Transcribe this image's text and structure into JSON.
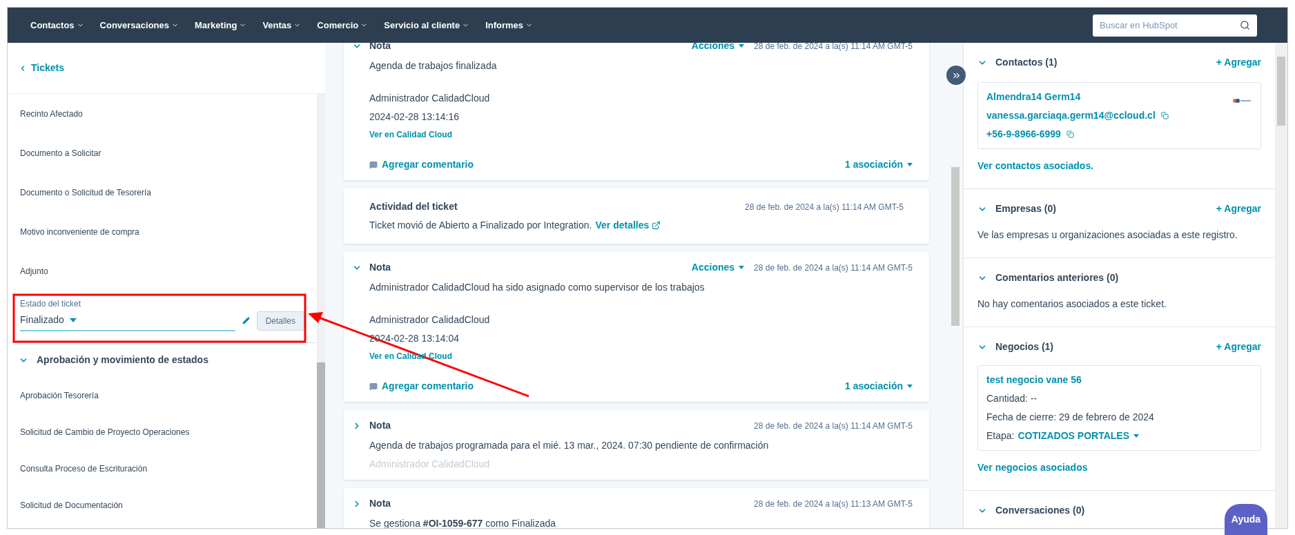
{
  "nav": {
    "items": [
      "Contactos",
      "Conversaciones",
      "Marketing",
      "Ventas",
      "Comercio",
      "Servicio al cliente",
      "Informes"
    ],
    "search": {
      "placeholder": "Buscar en HubSpot"
    }
  },
  "left": {
    "back_link": "Tickets",
    "fields": [
      "Recinto Afectado",
      "Documento a Solicitar",
      "Documento o Solicitud de Tesorería",
      "Motivo inconveniente de compra",
      "Adjunto"
    ],
    "status_field": {
      "label": "Estado del ticket",
      "value": "Finalizado",
      "button": "Detalles"
    },
    "section": {
      "title": "Aprobación y movimiento de estados",
      "expanded": true,
      "fields": [
        "Aprobación Tesorería",
        "Solicitud de Cambio de Proyecto Operaciones",
        "Consulta Proceso de Escrituración",
        "Solicitud de Documentación"
      ]
    }
  },
  "feed": [
    {
      "kind": "note",
      "expanded": true,
      "title": "Nota",
      "actions": "Acciones",
      "date": "28 de feb. de 2024 a la(s) 11:14 AM GMT-5",
      "body": "Agenda de trabajos finalizada",
      "author": "Administrador CalidadCloud",
      "timestamp": "2024-02-28 13:14:16",
      "link": "Ver en Calidad Cloud",
      "comment": "Agregar comentario",
      "associations": "1 asociación"
    },
    {
      "kind": "activity",
      "title": "Actividad del ticket",
      "date": "28 de feb. de 2024 a la(s) 11:14 AM GMT-5",
      "body": "Ticket movió de Abierto a Finalizado por Integration.",
      "link": "Ver detalles"
    },
    {
      "kind": "note",
      "expanded": true,
      "title": "Nota",
      "actions": "Acciones",
      "date": "28 de feb. de 2024 a la(s) 11:14 AM GMT-5",
      "body": "Administrador CalidadCloud ha sido asignado como supervisor de los trabajos",
      "author": "Administrador CalidadCloud",
      "timestamp": "2024-02-28 13:14:04",
      "link": "Ver en Calidad Cloud",
      "comment": "Agregar comentario",
      "associations": "1 asociación"
    },
    {
      "kind": "note",
      "expanded": false,
      "title": "Nota",
      "date": "28 de feb. de 2024 a la(s) 11:14 AM GMT-5",
      "body": "Agenda de trabajos programada para el mié. 13 mar., 2024. 07:30 pendiente de confirmación",
      "faded": "Administrador CalidadCloud"
    },
    {
      "kind": "note",
      "expanded": false,
      "title": "Nota",
      "date": "28 de feb. de 2024 a la(s) 11:13 AM GMT-5",
      "body": "Se gestiona **#OI-1059-677** como Finalizada"
    }
  ],
  "right": [
    {
      "kind": "contact",
      "title": "Contactos (1)",
      "expanded": true,
      "add": "+ Agregar",
      "card": {
        "name": "Almendra14 Germ14",
        "email": "vanessa.garciaqa.germ14@ccloud.cl",
        "phone": "+56-9-8966-6999"
      },
      "link": "Ver contactos asociados."
    },
    {
      "kind": "text",
      "title": "Empresas (0)",
      "expanded": true,
      "add": "+ Agregar",
      "text": "Ve las empresas u organizaciones asociadas a este registro."
    },
    {
      "kind": "text",
      "title": "Comentarios anteriores (0)",
      "expanded": true,
      "text": "No hay comentarios asociados a este ticket."
    },
    {
      "kind": "deal",
      "title": "Negocios (1)",
      "expanded": true,
      "add": "+ Agregar",
      "card": {
        "name": "test negocio vane 56",
        "lines": [
          "Cantidad: --",
          "Fecha de cierre: 29 de febrero de 2024"
        ],
        "stage_label": "Etapa:",
        "stage": "COTIZADOS PORTALES"
      },
      "link": "Ver negocios asociados"
    },
    {
      "kind": "text",
      "title": "Conversaciones (0)",
      "expanded": true
    }
  ],
  "help": "Ayuda"
}
